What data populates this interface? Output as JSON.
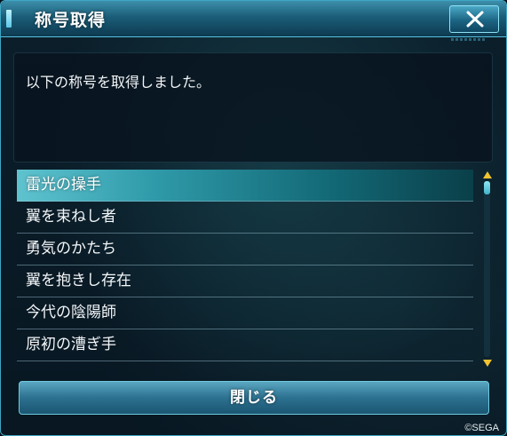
{
  "window": {
    "title": "称号取得",
    "close_icon": "close-x-icon"
  },
  "message": {
    "text": "以下の称号を取得しました。"
  },
  "titles": [
    {
      "label": "雷光の操手",
      "selected": true
    },
    {
      "label": "翼を束ねし者",
      "selected": false
    },
    {
      "label": "勇気のかたち",
      "selected": false
    },
    {
      "label": "翼を抱きし存在",
      "selected": false
    },
    {
      "label": "今代の陰陽師",
      "selected": false
    },
    {
      "label": "原初の漕ぎ手",
      "selected": false
    }
  ],
  "scrollbar": {
    "up_icon": "scroll-up-arrow-icon",
    "down_icon": "scroll-down-arrow-icon"
  },
  "footer": {
    "close_button_label": "閉じる",
    "copyright": "©SEGA"
  },
  "colors": {
    "accent": "#3fa6c4",
    "selected_row": "#2f9aa9",
    "scroll_arrow": "#f2c230"
  }
}
